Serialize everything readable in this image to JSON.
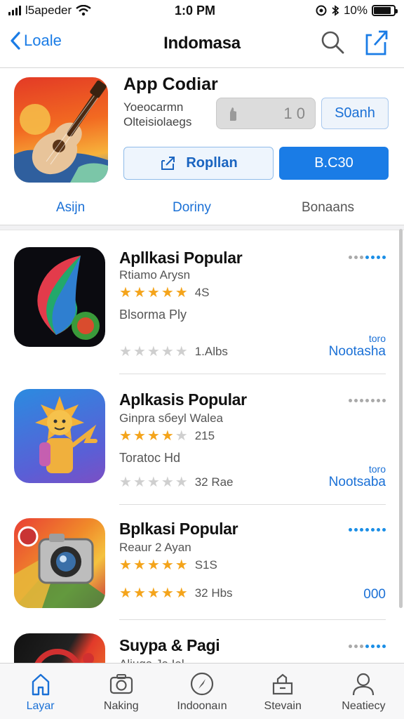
{
  "status_bar": {
    "carrier": "Ɩ5apeder",
    "time": "1:0 PM",
    "battery_text": "10%",
    "battery_level": 0.85
  },
  "navbar": {
    "back_label": "Loale",
    "title": "Indomasa"
  },
  "featured": {
    "title": "App Codiar",
    "subtitle_line1": "Yoeocarmn",
    "subtitle_line2": "Olteisiolaegs",
    "rating_value": "1 0",
    "search_label": "S0anh",
    "popular_label": "Ropllan",
    "price_label": "B.C30",
    "segments": [
      "Asijn",
      "Doriny",
      "Bonaans"
    ]
  },
  "apps": [
    {
      "title": "Apllkasi Popular",
      "subtitle": "Rtiamo Arysn",
      "stars": 4.5,
      "rating_count": "4S",
      "description": "Blsorma Ply",
      "small_label": "",
      "secondary_stars": "1.Albs",
      "action_small": "toro",
      "action_label": "Nootasha"
    },
    {
      "title": "Aplkasis Popular",
      "subtitle": "Ginpra sбeyl Walea",
      "stars": 4,
      "rating_count": "215",
      "description": "Toratoc Hd",
      "secondary_stars": "32 Rae",
      "action_small": "toro",
      "action_label": "Nootsaba"
    },
    {
      "title": "Bplkasi Popular",
      "subtitle": "Reaur 2 Ayan",
      "stars": 4.5,
      "rating_count": "S1S",
      "description": "",
      "secondary_stars": "32 Hbs",
      "action_small": "",
      "action_label": "000"
    },
    {
      "title": "Suypa & Pagi",
      "subtitle": "Aljuga Ja Ial",
      "stars": 0,
      "rating_count": "",
      "description": "",
      "secondary_stars": "",
      "action_small": "",
      "action_label": ""
    }
  ],
  "tabs": [
    {
      "label": "Layar",
      "icon": "home-icon",
      "active": true
    },
    {
      "label": "Naking",
      "icon": "camera-icon",
      "active": false
    },
    {
      "label": "Indoonaın",
      "icon": "compass-icon",
      "active": false
    },
    {
      "label": "Stevain",
      "icon": "bag-icon",
      "active": false
    },
    {
      "label": "Neatiecy",
      "icon": "person-icon",
      "active": false
    }
  ],
  "colors": {
    "accent": "#1a7ce6",
    "star": "#f4a41b",
    "tab_active": "#1a70d6"
  }
}
